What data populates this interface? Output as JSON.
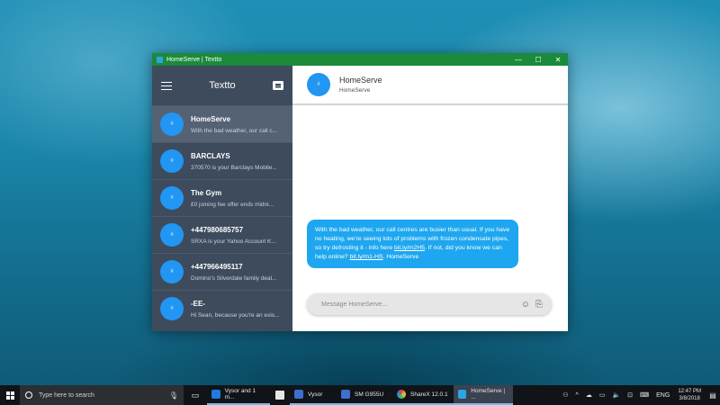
{
  "window": {
    "title": "HomeServe | Textto",
    "controls": {
      "minimize": "—",
      "maximize": "☐",
      "close": "✕"
    }
  },
  "sidebar": {
    "title": "Textto",
    "conversations": [
      {
        "name": "HomeServe",
        "preview": "With the bad weather, our call c...",
        "active": true
      },
      {
        "name": "BARCLAYS",
        "preview": "370570 is your Barclays Mobile..."
      },
      {
        "name": "The Gym",
        "preview": "£0 joining fee offer ends midni..."
      },
      {
        "name": "+447980685757",
        "preview": "SRXA is your Yahoo Account K..."
      },
      {
        "name": "+447966495117",
        "preview": "Domino's Silverdale family deal..."
      },
      {
        "name": "-EE-",
        "preview": "Hi Sean, because you're an exis..."
      }
    ]
  },
  "chat": {
    "contact_name": "HomeServe",
    "contact_sub": "HomeServe",
    "message": {
      "part1": "With the bad weather, our call centres are busier than usual. If you have no heating, we're seeing lots of problems with frozen condensate pipes, so try defrosting it - info here ",
      "link1": "bit.ly/m2H5",
      "part2": ". If not, did you know we can help online? ",
      "link2": "bit.ly/m1-HS",
      "part3": ". HomeServe"
    },
    "composer_placeholder": "Message HomeServe..."
  },
  "taskbar": {
    "search_placeholder": "Type here to search",
    "apps": [
      {
        "label": "Vysor and 1 m...",
        "color": "#1e7be0"
      },
      {
        "label": "",
        "color": "#e6e6e6"
      },
      {
        "label": "Vysor",
        "color": "#3b6fd0"
      },
      {
        "label": "SM G955U",
        "color": "#3b6fd0"
      },
      {
        "label": "ShareX 12.0.1",
        "color": "#e03b3b"
      },
      {
        "label": "HomeServe | ...",
        "color": "#2aa6e8"
      }
    ],
    "language": "ENG",
    "time": "12:47 PM",
    "date": "3/8/2018"
  }
}
